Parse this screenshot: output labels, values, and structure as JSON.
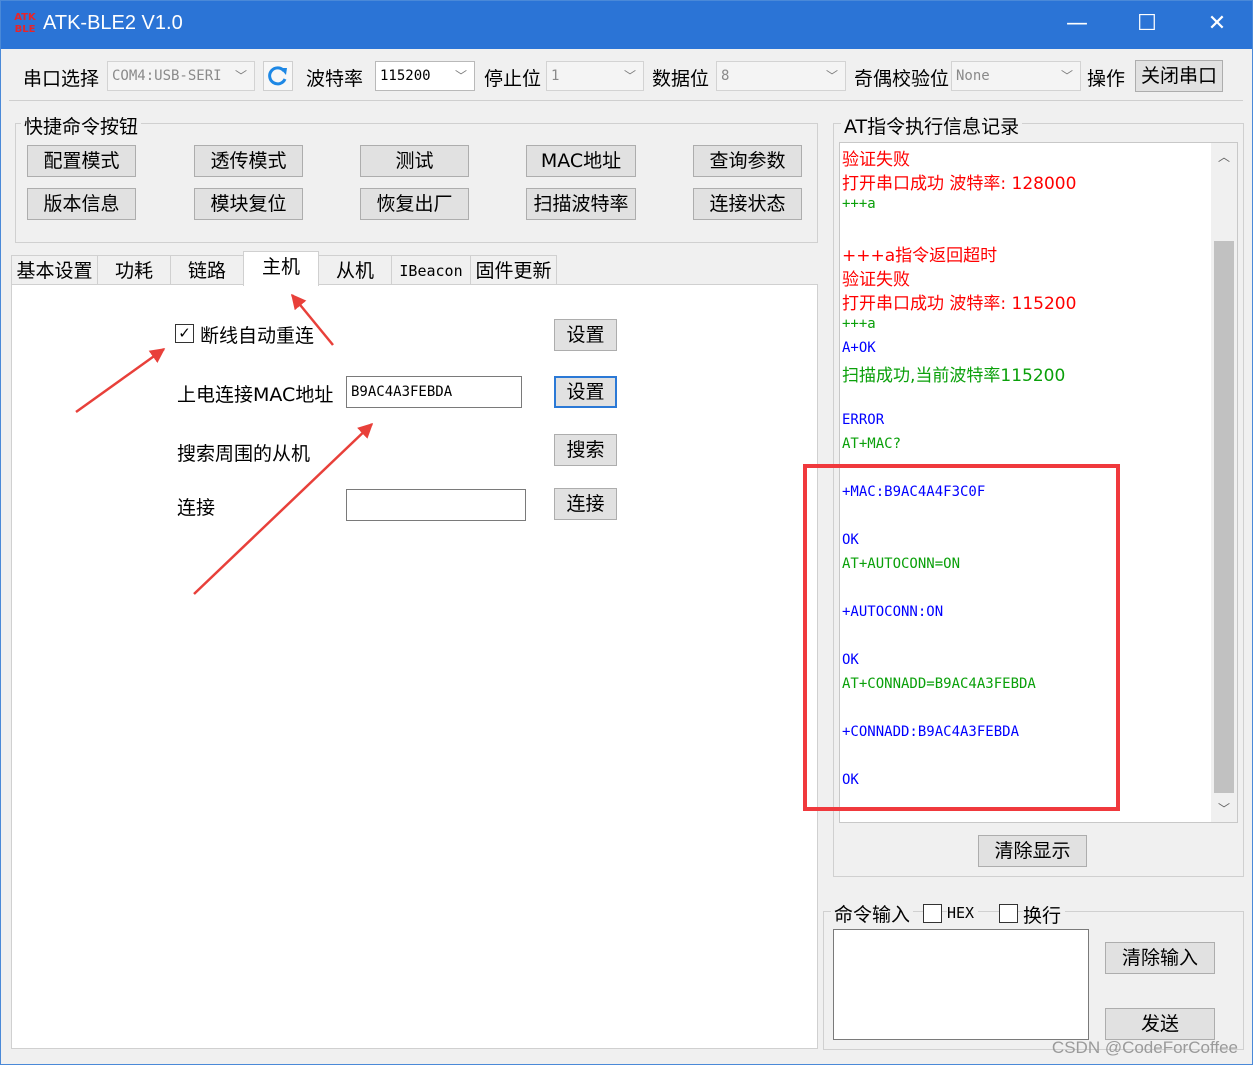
{
  "window": {
    "logo": "ATK BLE",
    "title": "ATK-BLE2 V1.0",
    "minimize": "—",
    "maximize": "☐",
    "close": "✕"
  },
  "toolbar": {
    "port_label": "串口选择",
    "port_value": "COM4:USB-SERI",
    "baud_label": "波特率",
    "baud_value": "115200",
    "stop_label": "停止位",
    "stop_value": "1",
    "data_label": "数据位",
    "data_value": "8",
    "parity_label": "奇偶校验位",
    "parity_value": "None",
    "op_label": "操作",
    "close_port_button": "关闭串口"
  },
  "quick_commands": {
    "title": "快捷命令按钮",
    "row1": [
      "配置模式",
      "透传模式",
      "测试",
      "MAC地址",
      "查询参数"
    ],
    "row2": [
      "版本信息",
      "模块复位",
      "恢复出厂",
      "扫描波特率",
      "连接状态"
    ]
  },
  "tabs": [
    "基本设置",
    "功耗",
    "链路",
    "主机",
    "从机",
    "IBeacon",
    "固件更新"
  ],
  "host_panel": {
    "auto_reconnect_label": "断线自动重连",
    "auto_reconnect_checked": true,
    "auto_reconnect_set": "设置",
    "power_mac_label": "上电连接MAC地址",
    "power_mac_value": "B9AC4A3FEBDA",
    "power_mac_set": "设置",
    "search_label": "搜索周围的从机",
    "search_button": "搜索",
    "connect_label": "连接",
    "connect_value": "",
    "connect_button": "连接"
  },
  "log": {
    "title": "AT指令执行信息记录",
    "lines": [
      {
        "text": "验证失败",
        "color": "#ff0000",
        "mono": false
      },
      {
        "text": "打开串口成功   波特率: 128000",
        "color": "#ff0000",
        "mono": false
      },
      {
        "text": "+++a",
        "color": "#0aa00a",
        "mono": true
      },
      {
        "text": "",
        "color": "#000000",
        "mono": false
      },
      {
        "text": "+++a指令返回超时",
        "color": "#ff0000",
        "mono": false
      },
      {
        "text": "验证失败",
        "color": "#ff0000",
        "mono": false
      },
      {
        "text": "打开串口成功   波特率: 115200",
        "color": "#ff0000",
        "mono": false
      },
      {
        "text": "+++a",
        "color": "#0aa00a",
        "mono": true
      },
      {
        "text": "A+OK",
        "color": "#0000ff",
        "mono": true
      },
      {
        "text": "扫描成功,当前波特率115200",
        "color": "#0aa00a",
        "mono": false
      },
      {
        "text": "",
        "color": "#000000",
        "mono": false
      },
      {
        "text": "ERROR",
        "color": "#0000ff",
        "mono": true
      },
      {
        "text": "AT+MAC?",
        "color": "#0aa00a",
        "mono": true
      },
      {
        "text": "",
        "color": "#000000",
        "mono": false
      },
      {
        "text": "+MAC:B9AC4A4F3C0F",
        "color": "#0000ff",
        "mono": true
      },
      {
        "text": "",
        "color": "#000000",
        "mono": false
      },
      {
        "text": "OK",
        "color": "#0000ff",
        "mono": true
      },
      {
        "text": "AT+AUTOCONN=ON",
        "color": "#0aa00a",
        "mono": true
      },
      {
        "text": "",
        "color": "#000000",
        "mono": false
      },
      {
        "text": "+AUTOCONN:ON",
        "color": "#0000ff",
        "mono": true
      },
      {
        "text": "",
        "color": "#000000",
        "mono": false
      },
      {
        "text": "OK",
        "color": "#0000ff",
        "mono": true
      },
      {
        "text": "AT+CONNADD=B9AC4A3FEBDA",
        "color": "#0aa00a",
        "mono": true
      },
      {
        "text": "",
        "color": "#000000",
        "mono": false
      },
      {
        "text": "+CONNADD:B9AC4A3FEBDA",
        "color": "#0000ff",
        "mono": true
      },
      {
        "text": "",
        "color": "#000000",
        "mono": false
      },
      {
        "text": "OK",
        "color": "#0000ff",
        "mono": true
      }
    ],
    "clear_display_button": "清除显示"
  },
  "command_input": {
    "title": "命令输入",
    "hex_label": "HEX",
    "hex_checked": false,
    "newline_label": "换行",
    "newline_checked": false,
    "value": "",
    "clear_input_button": "清除输入",
    "send_button": "发送"
  },
  "watermark": "CSDN @CodeForCoffee",
  "colors": {
    "titlebar": "#2b74d6",
    "highlight": "#f0393d",
    "log_red": "#ff0000",
    "log_green": "#0aa00a",
    "log_blue": "#0000ff"
  }
}
